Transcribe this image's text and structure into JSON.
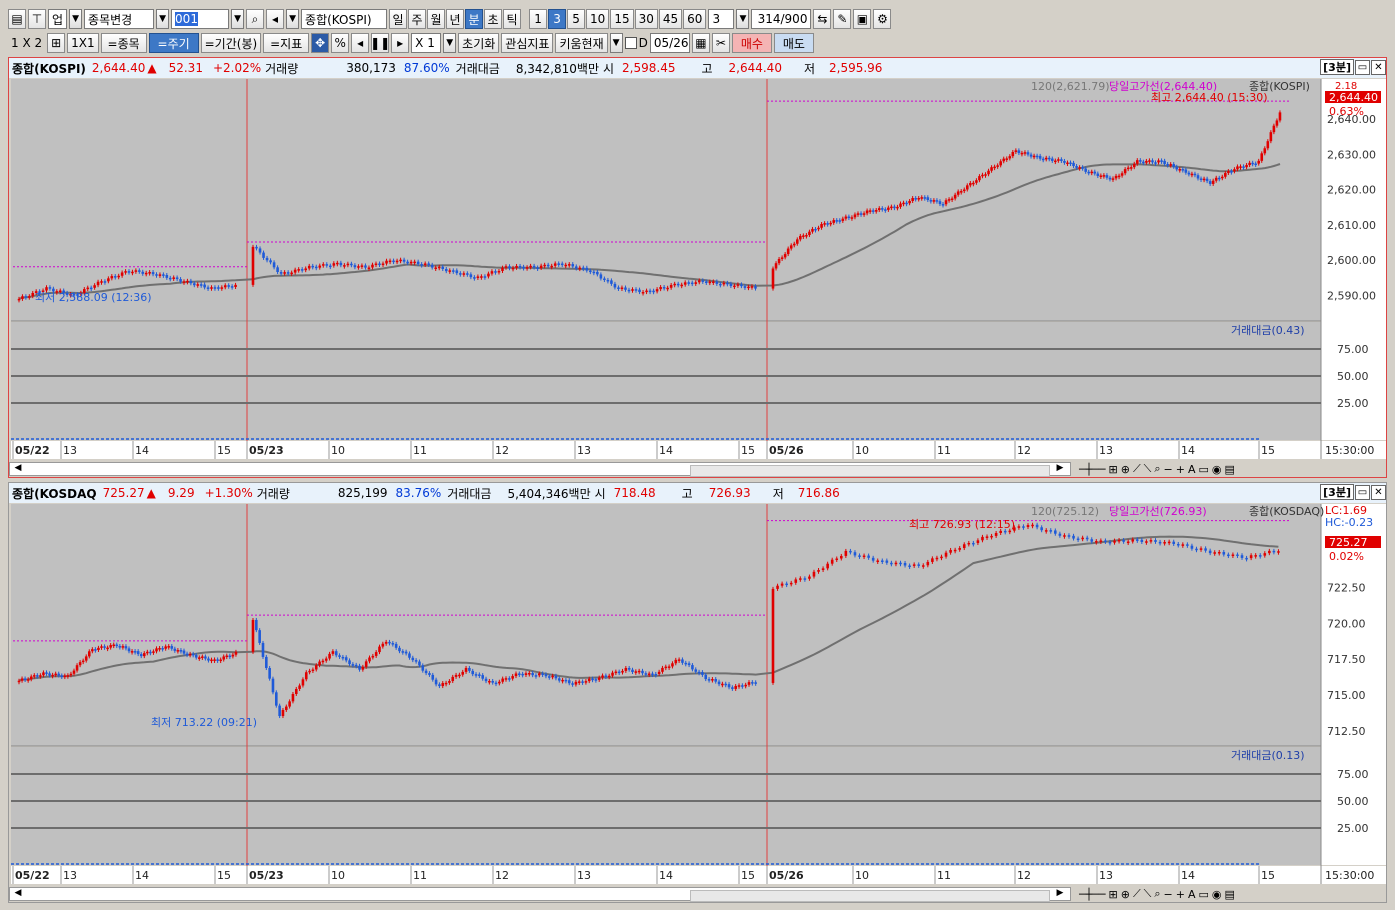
{
  "toolbar1": {
    "layout_label": "업",
    "item_change_label": "종목변경",
    "code_value": "001",
    "search_name": "종합(KOSPI)",
    "periods": [
      "일",
      "주",
      "월",
      "년",
      "분",
      "초",
      "틱"
    ],
    "active_period": "분",
    "intervals": [
      "1",
      "3",
      "5",
      "10",
      "15",
      "30",
      "45",
      "60"
    ],
    "active_interval": "3",
    "count_value": "3",
    "data_count": "314",
    "data_total": "/900"
  },
  "toolbar2": {
    "layout": "1 X 2",
    "one_by_one": "1X1",
    "item_btn": "=종목",
    "period_btn": "=주기",
    "range_btn": "=기간(봉)",
    "indicator_btn": "=지표",
    "percent_label": "%",
    "multiplier": "X 1",
    "reset_btn": "초기화",
    "watch_btn": "관심지표",
    "kiwoom_btn": "키움현재",
    "date_check_label": "D",
    "date_value": "05/26",
    "buy_btn": "매수",
    "sell_btn": "매도"
  },
  "colors": {
    "up": "#e00000",
    "down": "#1f5ad8",
    "magenta": "#d000d0",
    "ma": "#707070",
    "plot_bg": "#c0c0c0"
  },
  "panels": [
    {
      "header": {
        "name": "종합(KOSPI)",
        "price": "2,644.40",
        "arrow": "▲",
        "change": "52.31",
        "pct": "+2.02%",
        "vol_label": "거래량",
        "volume": "380,173",
        "vol_ratio": "87.60%",
        "amount_label": "거래대금",
        "amount": "8,342,810백만",
        "open_label": "시",
        "open": "2,598.45",
        "high_label": "고",
        "high": "2,644.40",
        "low_label": "저",
        "low": "2,595.96",
        "timeframe": "[3분]"
      },
      "legend": {
        "ma": "120(2,621.79)",
        "dayhigh": "당일고가선(2,644.40)",
        "name": "종합(KOSPI)"
      },
      "annotations": {
        "high": "최고 2,644.40 (15:30)",
        "low": "최저 2,588.09 (12:36)"
      },
      "price_axis": [
        "2,640.00",
        "2,630.00",
        "2,620.00",
        "2,610.00",
        "2,600.00",
        "2,590.00"
      ],
      "price_tags": {
        "current": "2,644.40",
        "pct": "0.63%",
        "extra": "2.18"
      },
      "vol_legend": "거래대금(0.43)",
      "vol_axis": [
        "75.00",
        "50.00",
        "25.00"
      ],
      "time_labels": [
        "05/22",
        "13",
        "14",
        "15",
        "05/23",
        "10",
        "11",
        "12",
        "13",
        "14",
        "15",
        "05/26",
        "10",
        "11",
        "12",
        "13",
        "14",
        "15"
      ],
      "time_axis_end": "15:30:00"
    },
    {
      "header": {
        "name": "종합(KOSDAQ",
        "price": "725.27",
        "arrow": "▲",
        "change": "9.29",
        "pct": "+1.30%",
        "vol_label": "거래량",
        "volume": "825,199",
        "vol_ratio": "83.76%",
        "amount_label": "거래대금",
        "amount": "5,404,346백만",
        "open_label": "시",
        "open": "718.48",
        "high_label": "고",
        "high": "726.93",
        "low_label": "저",
        "low": "716.86",
        "timeframe": "[3분]"
      },
      "legend": {
        "ma": "120(725.12)",
        "dayhigh": "당일고가선(726.93)",
        "name": "종합(KOSDAQ)"
      },
      "annotations": {
        "high": "최고 726.93 (12:15)",
        "low": "최저 713.22 (09:21)"
      },
      "price_axis": [
        "722.50",
        "720.00",
        "717.50",
        "715.00",
        "712.50"
      ],
      "price_tags": {
        "current": "725.27",
        "pct": "0.02%",
        "lc": "LC:1.69",
        "hc": "HC:-0.23"
      },
      "vol_legend": "거래대금(0.13)",
      "vol_axis": [
        "75.00",
        "50.00",
        "25.00"
      ],
      "time_labels": [
        "05/22",
        "13",
        "14",
        "15",
        "05/23",
        "10",
        "11",
        "12",
        "13",
        "14",
        "15",
        "05/26",
        "10",
        "11",
        "12",
        "13",
        "14",
        "15"
      ],
      "time_axis_end": "15:30:00"
    }
  ],
  "chart_data": [
    {
      "type": "candlestick",
      "title": "종합(KOSPI)",
      "series": [
        {
          "name": "120",
          "type": "moving-average"
        }
      ],
      "ylim": [
        2585,
        2648
      ],
      "session_high": 2644.4,
      "session_low": 2588.09,
      "sessions": [
        {
          "date": "05/22",
          "close_points": [
            2589,
            2592,
            2590,
            2594,
            2597,
            2596,
            2594,
            2592,
            2593
          ]
        },
        {
          "date": "05/23",
          "close_points": [
            2604,
            2596,
            2598,
            2599,
            2598,
            2600,
            2599,
            2597,
            2595,
            2598,
            2598,
            2599,
            2597,
            2592,
            2591,
            2593,
            2594,
            2593,
            2592
          ]
        },
        {
          "date": "05/26",
          "close_points": [
            2598,
            2606,
            2610,
            2612,
            2614,
            2615,
            2618,
            2616,
            2621,
            2626,
            2631,
            2629,
            2628,
            2625,
            2623,
            2628,
            2628,
            2625,
            2622,
            2626,
            2628,
            2644
          ]
        }
      ]
    },
    {
      "type": "candlestick",
      "title": "종합(KOSDAQ)",
      "series": [
        {
          "name": "120",
          "type": "moving-average"
        }
      ],
      "ylim": [
        712,
        727.5
      ],
      "session_high": 726.93,
      "session_low": 713.22,
      "sessions": [
        {
          "date": "05/22",
          "close_points": [
            716.0,
            716.5,
            716.3,
            718.2,
            718.5,
            717.8,
            718.4,
            717.8,
            717.4,
            718.0
          ]
        },
        {
          "date": "05/23",
          "close_points": [
            720.3,
            713.5,
            716.5,
            718.0,
            716.8,
            718.8,
            717.5,
            715.6,
            716.8,
            715.8,
            716.5,
            716.4,
            715.8,
            716.2,
            716.8,
            716.4,
            717.5,
            716.2,
            715.5,
            716.0
          ]
        },
        {
          "date": "05/26",
          "close_points": [
            722.5,
            723.3,
            725.0,
            724.3,
            724.0,
            725.2,
            726.2,
            726.9,
            726.1,
            725.7,
            725.8,
            725.6,
            725.0,
            724.6,
            725.2
          ]
        }
      ]
    }
  ]
}
